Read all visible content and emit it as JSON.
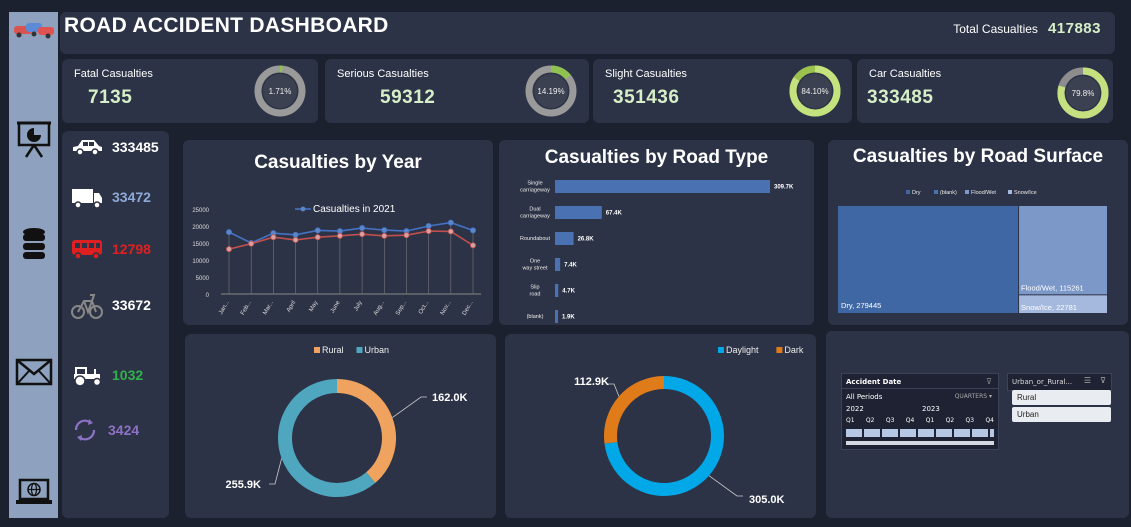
{
  "header": {
    "title": "ROAD ACCIDENT DASHBOARD",
    "total_label": "Total Casualties",
    "total_value": "417883"
  },
  "kpis": [
    {
      "label": "Fatal Casualties",
      "value": "7135",
      "pct_text": "1.71%",
      "pct": 1.71
    },
    {
      "label": "Serious Casualties",
      "value": "59312",
      "pct_text": "14.19%",
      "pct": 14.19
    },
    {
      "label": "Slight Casualties",
      "value": "351436",
      "pct_text": "84.10%",
      "pct": 84.1
    },
    {
      "label": "Car Casualties",
      "value": "333485",
      "pct_text": "79.8%",
      "pct": 79.8
    }
  ],
  "vehicles": [
    {
      "icon": "car-icon",
      "value": "333485",
      "color": "#ffffff"
    },
    {
      "icon": "truck-icon",
      "value": "33472",
      "color": "#8ea9d8"
    },
    {
      "icon": "bus-icon",
      "value": "12798",
      "color": "#e02020"
    },
    {
      "icon": "bicycle-icon",
      "value": "33672",
      "color": "#ffffff"
    },
    {
      "icon": "tractor-icon",
      "value": "1032",
      "color": "#2fb24c"
    },
    {
      "icon": "refresh-icon",
      "value": "3424",
      "color": "#8c72c4"
    }
  ],
  "sidebar_icons": [
    "presentation-icon",
    "database-icon",
    "mail-icon",
    "laptop-globe-icon"
  ],
  "chart_data": [
    {
      "type": "line",
      "title": "Casualties by Year",
      "legend": "Casualties in 2021",
      "categories": [
        "Jan...",
        "Feb...",
        "Mar...",
        "April",
        "May",
        "June",
        "July",
        "Aug...",
        "Sep...",
        "Oct...",
        "Nov...",
        "Dec..."
      ],
      "ylim": [
        0,
        25000
      ],
      "yticks": [
        "0",
        "5000",
        "10000",
        "15000",
        "20000",
        "25000"
      ],
      "series": [
        {
          "name": "Casualties in 2021",
          "color": "#4472c4",
          "values": [
            18200,
            15000,
            17900,
            17400,
            18700,
            18500,
            19400,
            18800,
            18500,
            20000,
            21000,
            18700
          ]
        },
        {
          "values": [
            13200,
            14800,
            16700,
            15900,
            16700,
            17100,
            17600,
            17100,
            17300,
            18500,
            18400,
            14300
          ],
          "color": "#c0504d"
        }
      ]
    },
    {
      "type": "bar",
      "title": "Casualties by Road Type",
      "categories": [
        "Single carriageway",
        "Dual carriageway",
        "Roundabout",
        "One way street",
        "Slip road",
        "(blank)"
      ],
      "values": [
        309.7,
        67.4,
        26.8,
        7.4,
        4.7,
        1.9
      ],
      "labels": [
        "309.7K",
        "67.4K",
        "26.8K",
        "7.4K",
        "4.7K",
        "1.9K"
      ]
    },
    {
      "type": "heatmap",
      "title": "Casualties by Road Surface",
      "legend": [
        "Dry",
        "(blank)",
        "Flood/Wet",
        "Snow/Ice"
      ],
      "items": [
        {
          "name": "Dry",
          "value": 279445,
          "label": "Dry, 279445",
          "color": "#3f67a3"
        },
        {
          "name": "Flood/Wet",
          "value": 115261,
          "label": "Flood/Wet, 115261",
          "color": "#7b98c9"
        },
        {
          "name": "Snow/Ice",
          "value": 22781,
          "label": "Snow/Ice, 22781",
          "color": "#a4b9dd"
        }
      ]
    },
    {
      "type": "pie",
      "legend": [
        "Rural",
        "Urban"
      ],
      "values": [
        162.0,
        255.9
      ],
      "labels": [
        "162.0K",
        "255.9K"
      ],
      "colors": [
        "#f0a35e",
        "#4fa6bf"
      ]
    },
    {
      "type": "pie",
      "legend": [
        "Daylight",
        "Dark"
      ],
      "values": [
        305.0,
        112.9
      ],
      "labels": [
        "305.0K",
        "112.9K"
      ],
      "colors": [
        "#00a8e8",
        "#e07b1a"
      ]
    }
  ],
  "slicers": {
    "date": {
      "title": "Accident Date",
      "periods": "All Periods",
      "level": "QUARTERS",
      "years": [
        "2022",
        "2023"
      ],
      "quarters": [
        "Q1",
        "Q2",
        "Q3",
        "Q4",
        "Q1",
        "Q2",
        "Q3",
        "Q4"
      ]
    },
    "urban": {
      "title": "Urban_or_Rural...",
      "options": [
        "Rural",
        "Urban"
      ]
    }
  }
}
